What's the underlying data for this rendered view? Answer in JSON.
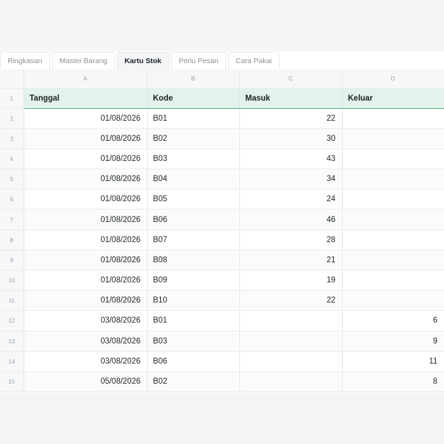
{
  "tabs": [
    {
      "label": "Ringkasan",
      "active": false
    },
    {
      "label": "Master Barang",
      "active": false
    },
    {
      "label": "Kartu Stok",
      "active": true
    },
    {
      "label": "Perlu Pesan",
      "active": false
    },
    {
      "label": "Cara Pakai",
      "active": false
    }
  ],
  "columns": [
    "A",
    "B",
    "C",
    "D"
  ],
  "headers": [
    "Tanggal",
    "Kode",
    "Masuk",
    "Keluar"
  ],
  "header_row_number": "1",
  "rows": [
    {
      "n": "2",
      "tanggal": "01/08/2026",
      "kode": "B01",
      "masuk": "22",
      "keluar": ""
    },
    {
      "n": "3",
      "tanggal": "01/08/2026",
      "kode": "B02",
      "masuk": "30",
      "keluar": ""
    },
    {
      "n": "4",
      "tanggal": "01/08/2026",
      "kode": "B03",
      "masuk": "43",
      "keluar": ""
    },
    {
      "n": "5",
      "tanggal": "01/08/2026",
      "kode": "B04",
      "masuk": "34",
      "keluar": ""
    },
    {
      "n": "6",
      "tanggal": "01/08/2026",
      "kode": "B05",
      "masuk": "24",
      "keluar": ""
    },
    {
      "n": "7",
      "tanggal": "01/08/2026",
      "kode": "B06",
      "masuk": "46",
      "keluar": ""
    },
    {
      "n": "8",
      "tanggal": "01/08/2026",
      "kode": "B07",
      "masuk": "28",
      "keluar": ""
    },
    {
      "n": "9",
      "tanggal": "01/08/2026",
      "kode": "B08",
      "masuk": "21",
      "keluar": ""
    },
    {
      "n": "10",
      "tanggal": "01/08/2026",
      "kode": "B09",
      "masuk": "19",
      "keluar": ""
    },
    {
      "n": "11",
      "tanggal": "01/08/2026",
      "kode": "B10",
      "masuk": "22",
      "keluar": ""
    },
    {
      "n": "12",
      "tanggal": "03/08/2026",
      "kode": "B01",
      "masuk": "",
      "keluar": "6"
    },
    {
      "n": "13",
      "tanggal": "03/08/2026",
      "kode": "B03",
      "masuk": "",
      "keluar": "9"
    },
    {
      "n": "14",
      "tanggal": "03/08/2026",
      "kode": "B06",
      "masuk": "",
      "keluar": "11"
    },
    {
      "n": "15",
      "tanggal": "05/08/2026",
      "kode": "B02",
      "masuk": "",
      "keluar": "8"
    }
  ],
  "colors": {
    "header_fill": "#e3f2ea",
    "header_border": "#4caf7d",
    "gutter": "#f6f7f8"
  }
}
